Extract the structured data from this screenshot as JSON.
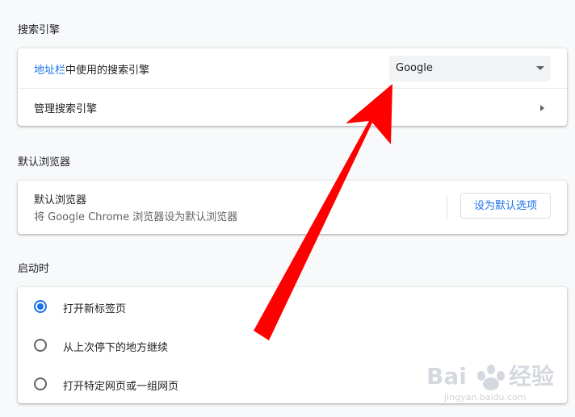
{
  "search_engine": {
    "title": "搜索引擎",
    "address_bar_link": "地址栏",
    "address_bar_rest": "中使用的搜索引擎",
    "selected_engine": "Google",
    "manage_label": "管理搜索引擎"
  },
  "default_browser": {
    "title": "默认浏览器",
    "heading": "默认浏览器",
    "description": "将 Google Chrome 浏览器设为默认浏览器",
    "button_label": "设为默认选项"
  },
  "on_startup": {
    "title": "启动时",
    "options": [
      {
        "label": "打开新标签页",
        "checked": true
      },
      {
        "label": "从上次停下的地方继续",
        "checked": false
      },
      {
        "label": "打开特定网页或一组网页",
        "checked": false
      }
    ]
  },
  "watermark": {
    "text": "Bai 经验",
    "sub": "jingyan.baidu.com"
  },
  "colors": {
    "accent": "#1a73e8",
    "annotation_arrow": "#ff0000",
    "background": "#f8f9fa"
  },
  "icons": [
    "dropdown-arrow-icon",
    "chevron-right-icon",
    "radio-checked-icon",
    "radio-unchecked-icon",
    "red-annotation-arrow"
  ]
}
